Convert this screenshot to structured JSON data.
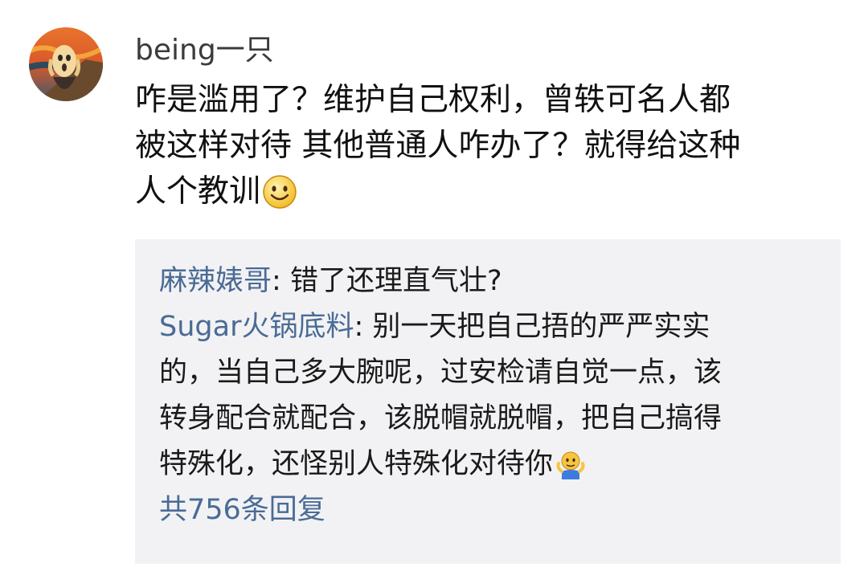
{
  "comment": {
    "username": "being一只",
    "avatar_icon": "avatar-scream-painting",
    "content_lines": [
      "咋是滥用了？维护自己权利，曾轶可名人都",
      "被这样对待 其他普通人咋办了？就得给这种",
      "人个教训"
    ],
    "content_emoji": "smile-emoji-icon"
  },
  "replies": {
    "items": [
      {
        "user": "麻辣婊哥",
        "separator": ": ",
        "lines": [
          "错了还理直气壮?"
        ]
      },
      {
        "user": "Sugar火锅底料",
        "separator": ": ",
        "lines": [
          "别一天把自己捂的严严实实",
          "的，当自己多大腕呢，过安检请自觉一点，该",
          "转身配合就配合，该脱帽就脱帽，把自己搞得",
          "特殊化，还怪别人特殊化对待你"
        ],
        "emoji": "shrug-emoji-icon"
      }
    ],
    "count_label": "共756条回复"
  },
  "colors": {
    "link_blue": "#4a6b95",
    "reply_bg": "#f2f2f4",
    "text": "#111111"
  }
}
